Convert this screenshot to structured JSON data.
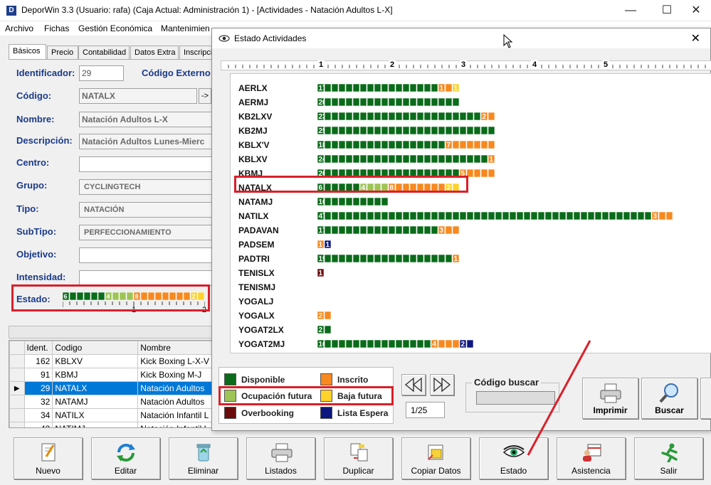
{
  "window": {
    "title": "DeporWin 3.3  (Usuario: rafa)  (Caja Actual: Administración 1) - [Actividades - Natación Adultos L-X]",
    "app_icon": "D",
    "min_glyph": "—",
    "max_glyph": "☐",
    "close_glyph": "✕"
  },
  "menu": [
    {
      "label": "Archivo"
    },
    {
      "label": "Fichas"
    },
    {
      "label": "Gestión Económica"
    },
    {
      "label": "Mantenimien"
    }
  ],
  "tabs": [
    "Básicos",
    "Precio",
    "Contabilidad",
    "Datos Extra",
    "Inscripci"
  ],
  "form": {
    "identificador_label": "Identificador:",
    "identificador_value": "29",
    "codigo_externo_label": "Código Externo",
    "codigo_label": "Código:",
    "codigo_value": "NATALX",
    "codigo_btn": "->",
    "nombre_label": "Nombre:",
    "nombre_value": "Natación Adultos L-X",
    "descripcion_label": "Descripción:",
    "descripcion_value": "Natación Adultos Lunes-Mierc",
    "centro_label": "Centro:",
    "centro_value": "",
    "grupo_label": "Grupo:",
    "grupo_value": "CYCLINGTECH",
    "tipo_label": "Tipo:",
    "tipo_value": "NATACIÓN",
    "subtipo_label": "SubTipo:",
    "subtipo_value": "PERFECCIONAMIENTO",
    "objetivo_label": "Objetivo:",
    "objetivo_value": "",
    "intensidad_label": "Intensidad:",
    "intensidad_value": "",
    "estado_label": "Estado:",
    "estado_ruler_labels": [
      "1",
      "2"
    ]
  },
  "grid": {
    "columns": [
      "Ident.",
      "Codigo",
      "Nombre"
    ],
    "rows": [
      {
        "ident": "162",
        "codigo": "KBLXV",
        "nombre": "Kick Boxing  L-X-V",
        "selected": false
      },
      {
        "ident": "91",
        "codigo": "KBMJ",
        "nombre": "Kick Boxing  M-J",
        "selected": false
      },
      {
        "ident": "29",
        "codigo": "NATALX",
        "nombre": "Natación Adultos",
        "selected": true
      },
      {
        "ident": "32",
        "codigo": "NATAMJ",
        "nombre": "Natación Adultos",
        "selected": false
      },
      {
        "ident": "34",
        "codigo": "NATILX",
        "nombre": "Natación Infantil L",
        "selected": false
      },
      {
        "ident": "42",
        "codigo": "NATIMJ",
        "nombre": "Natación Infantil L",
        "selected": false
      }
    ],
    "row_indicator": "▶"
  },
  "toolbar": [
    {
      "label": "Nuevo",
      "icon": "new-document-icon"
    },
    {
      "label": "Editar",
      "icon": "refresh-arrows-icon"
    },
    {
      "label": "Eliminar",
      "icon": "recycle-bin-icon"
    },
    {
      "label": "Listados",
      "icon": "printer-icon"
    },
    {
      "label": "Duplicar",
      "icon": "duplicate-icon"
    },
    {
      "label": "Copiar Datos",
      "icon": "copy-data-icon"
    },
    {
      "label": "Estado",
      "icon": "eye-icon"
    },
    {
      "label": "Asistencia",
      "icon": "calendar-person-icon"
    },
    {
      "label": "Salir",
      "icon": "running-man-icon"
    }
  ],
  "dialog": {
    "title": "Estado Actividades",
    "close_glyph": "✕",
    "ruler_labels": [
      "1",
      "2",
      "3",
      "4",
      "5"
    ],
    "legend": [
      {
        "label": "Disponible",
        "color": "#0a6b1a"
      },
      {
        "label": "Inscrito",
        "color": "#f7891f"
      },
      {
        "label": "Ocupación futura",
        "color": "#9dc454"
      },
      {
        "label": "Baja futura",
        "color": "#ffd22a"
      },
      {
        "label": "Overbooking",
        "color": "#6b0b0b"
      },
      {
        "label": "Lista Espera",
        "color": "#0d1780"
      }
    ],
    "pager": "1/25",
    "search_label": "Código buscar",
    "search_value": "",
    "imprimir": "Imprimir",
    "buscar": "Buscar"
  },
  "colors": {
    "disponible": "#0a6b1a",
    "inscrito": "#f7891f",
    "ocupacion_futura": "#9dc454",
    "baja_futura": "#ffd22a",
    "overbooking": "#6b0b0b",
    "lista_espera": "#0d1780",
    "label_blue": "#1a3a8a",
    "highlight_red": "#d9202a",
    "selection_blue": "#0078d7"
  },
  "chart_data": {
    "type": "bar",
    "title": "",
    "stacked": true,
    "orientation": "horizontal",
    "segment_order": [
      "disponible",
      "ocupacion_futura",
      "inscrito",
      "baja_futura",
      "overbooking",
      "lista_espera"
    ],
    "rows": [
      {
        "codigo": "AERLX",
        "counts": {
          "disponible": 17,
          "inscrito": 2,
          "ocupacion_futura": 0,
          "baja_futura": 1,
          "overbooking": 0,
          "lista_espera": 0
        },
        "labels": {
          "disponible": "17",
          "inscrito": "1",
          "baja_futura": "1"
        }
      },
      {
        "codigo": "AERMJ",
        "counts": {
          "disponible": 20,
          "inscrito": 0,
          "ocupacion_futura": 0,
          "baja_futura": 0,
          "overbooking": 0,
          "lista_espera": 0
        },
        "labels": {
          "disponible": "20"
        }
      },
      {
        "codigo": "KB2LXV",
        "counts": {
          "disponible": 23,
          "inscrito": 2,
          "ocupacion_futura": 0,
          "baja_futura": 0,
          "overbooking": 0,
          "lista_espera": 0
        },
        "labels": {
          "disponible": "23",
          "inscrito": "2"
        }
      },
      {
        "codigo": "KB2MJ",
        "counts": {
          "disponible": 25,
          "inscrito": 0,
          "ocupacion_futura": 0,
          "baja_futura": 0,
          "overbooking": 0,
          "lista_espera": 0
        },
        "labels": {
          "disponible": "25"
        }
      },
      {
        "codigo": "KBLX'V",
        "counts": {
          "disponible": 18,
          "inscrito": 7,
          "ocupacion_futura": 0,
          "baja_futura": 0,
          "overbooking": 0,
          "lista_espera": 0
        },
        "labels": {
          "disponible": "18",
          "inscrito": "7"
        }
      },
      {
        "codigo": "KBLXV",
        "counts": {
          "disponible": 24,
          "inscrito": 1,
          "ocupacion_futura": 0,
          "baja_futura": 0,
          "overbooking": 0,
          "lista_espera": 0
        },
        "labels": {
          "disponible": "24",
          "inscrito": "1"
        }
      },
      {
        "codigo": "KBMJ",
        "counts": {
          "disponible": 20,
          "inscrito": 5,
          "ocupacion_futura": 0,
          "baja_futura": 0,
          "overbooking": 0,
          "lista_espera": 0
        },
        "labels": {
          "disponible": "20",
          "inscrito": "5"
        }
      },
      {
        "codigo": "NATALX",
        "counts": {
          "disponible": 6,
          "inscrito": 8,
          "ocupacion_futura": 4,
          "baja_futura": 2,
          "overbooking": 0,
          "lista_espera": 0
        },
        "labels": {
          "disponible": "6",
          "ocupacion_futura": "4",
          "inscrito": "8",
          "baja_futura": "2"
        },
        "highlighted": true
      },
      {
        "codigo": "NATAMJ",
        "counts": {
          "disponible": 10,
          "inscrito": 0,
          "ocupacion_futura": 0,
          "baja_futura": 0,
          "overbooking": 0,
          "lista_espera": 0
        },
        "labels": {
          "disponible": "10"
        }
      },
      {
        "codigo": "NATILX",
        "counts": {
          "disponible": 47,
          "inscrito": 3,
          "ocupacion_futura": 0,
          "baja_futura": 0,
          "overbooking": 0,
          "lista_espera": 0
        },
        "labels": {
          "disponible": "47",
          "inscrito": "3"
        }
      },
      {
        "codigo": "PADAVAN",
        "counts": {
          "disponible": 17,
          "inscrito": 3,
          "ocupacion_futura": 0,
          "baja_futura": 0,
          "overbooking": 0,
          "lista_espera": 0
        },
        "labels": {
          "disponible": "17",
          "inscrito": "3"
        }
      },
      {
        "codigo": "PADSEM",
        "counts": {
          "disponible": 0,
          "inscrito": 1,
          "ocupacion_futura": 0,
          "baja_futura": 0,
          "overbooking": 0,
          "lista_espera": 1
        },
        "labels": {
          "inscrito": "1",
          "lista_espera": "1"
        }
      },
      {
        "codigo": "PADTRI",
        "counts": {
          "disponible": 19,
          "inscrito": 1,
          "ocupacion_futura": 0,
          "baja_futura": 0,
          "overbooking": 0,
          "lista_espera": 0
        },
        "labels": {
          "disponible": "19",
          "inscrito": "1"
        }
      },
      {
        "codigo": "TENISLX",
        "counts": {
          "disponible": 0,
          "inscrito": 0,
          "ocupacion_futura": 0,
          "baja_futura": 0,
          "overbooking": 1,
          "lista_espera": 0
        },
        "labels": {
          "overbooking": "1"
        }
      },
      {
        "codigo": "TENISMJ",
        "counts": {
          "disponible": 0,
          "inscrito": 0,
          "ocupacion_futura": 0,
          "baja_futura": 0,
          "overbooking": 0,
          "lista_espera": 0
        },
        "labels": {}
      },
      {
        "codigo": "YOGALJ",
        "counts": {
          "disponible": 0,
          "inscrito": 0,
          "ocupacion_futura": 0,
          "baja_futura": 0,
          "overbooking": 0,
          "lista_espera": 0
        },
        "labels": {}
      },
      {
        "codigo": "YOGALX",
        "counts": {
          "disponible": 0,
          "inscrito": 2,
          "ocupacion_futura": 0,
          "baja_futura": 0,
          "overbooking": 0,
          "lista_espera": 0
        },
        "labels": {
          "inscrito": "2"
        }
      },
      {
        "codigo": "YOGAT2LX",
        "counts": {
          "disponible": 2,
          "inscrito": 0,
          "ocupacion_futura": 0,
          "baja_futura": 0,
          "overbooking": 0,
          "lista_espera": 0
        },
        "labels": {
          "disponible": "2"
        }
      },
      {
        "codigo": "YOGAT2MJ",
        "counts": {
          "disponible": 16,
          "inscrito": 4,
          "ocupacion_futura": 0,
          "baja_futura": 0,
          "overbooking": 0,
          "lista_espera": 2
        },
        "labels": {
          "disponible": "16",
          "inscrito": "4",
          "lista_espera": "2"
        }
      }
    ],
    "mini": {
      "codigo": "NATALX",
      "counts": {
        "disponible": 6,
        "ocupacion_futura": 4,
        "inscrito": 8,
        "baja_futura": 2
      },
      "labels": {
        "disponible": "6",
        "ocupacion_futura": "4",
        "inscrito": "8",
        "baja_futura": "2"
      }
    }
  }
}
